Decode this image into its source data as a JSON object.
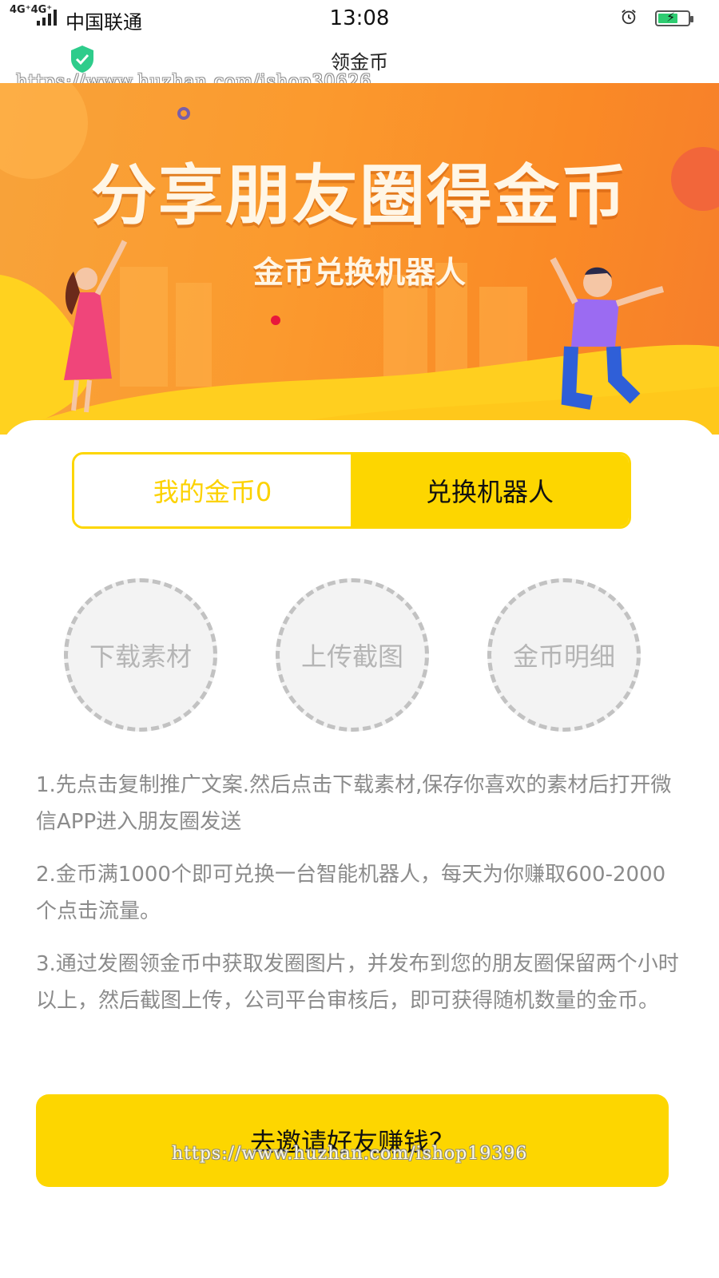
{
  "status_bar": {
    "network": "4G⁺4G⁺",
    "carrier": "中国联通",
    "time": "13:08",
    "battery_charging": true
  },
  "nav": {
    "title": "领金币",
    "watermark": "https://www.huzhan.com/ishop30626"
  },
  "banner": {
    "title": "分享朋友圈得金币",
    "subtitle": "金币兑换机器人"
  },
  "toggle": {
    "left_label": "我的金币0",
    "right_label": "兑换机器人"
  },
  "actions": [
    {
      "label": "下载素材"
    },
    {
      "label": "上传截图"
    },
    {
      "label": "金币明细"
    }
  ],
  "rules": [
    "1.先点击复制推广文案.然后点击下载素材,保存你喜欢的素材后打开微信APP进入朋友圈发送",
    "2.金币满1000个即可兑换一台智能机器人，每天为你赚取600-2000个点击流量。",
    "3.通过发圈领金币中获取发圈图片，并发布到您的朋友圈保留两个小时以上，然后截图上传，公司平台审核后，即可获得随机数量的金币。"
  ],
  "cta": {
    "label": "去邀请好友赚钱？",
    "watermark": "https://www.huzhan.com/ishop19396"
  },
  "colors": {
    "accent_yellow": "#fdd600",
    "banner_orange": "#fa8a26",
    "text_gray": "#8b8b8b"
  }
}
